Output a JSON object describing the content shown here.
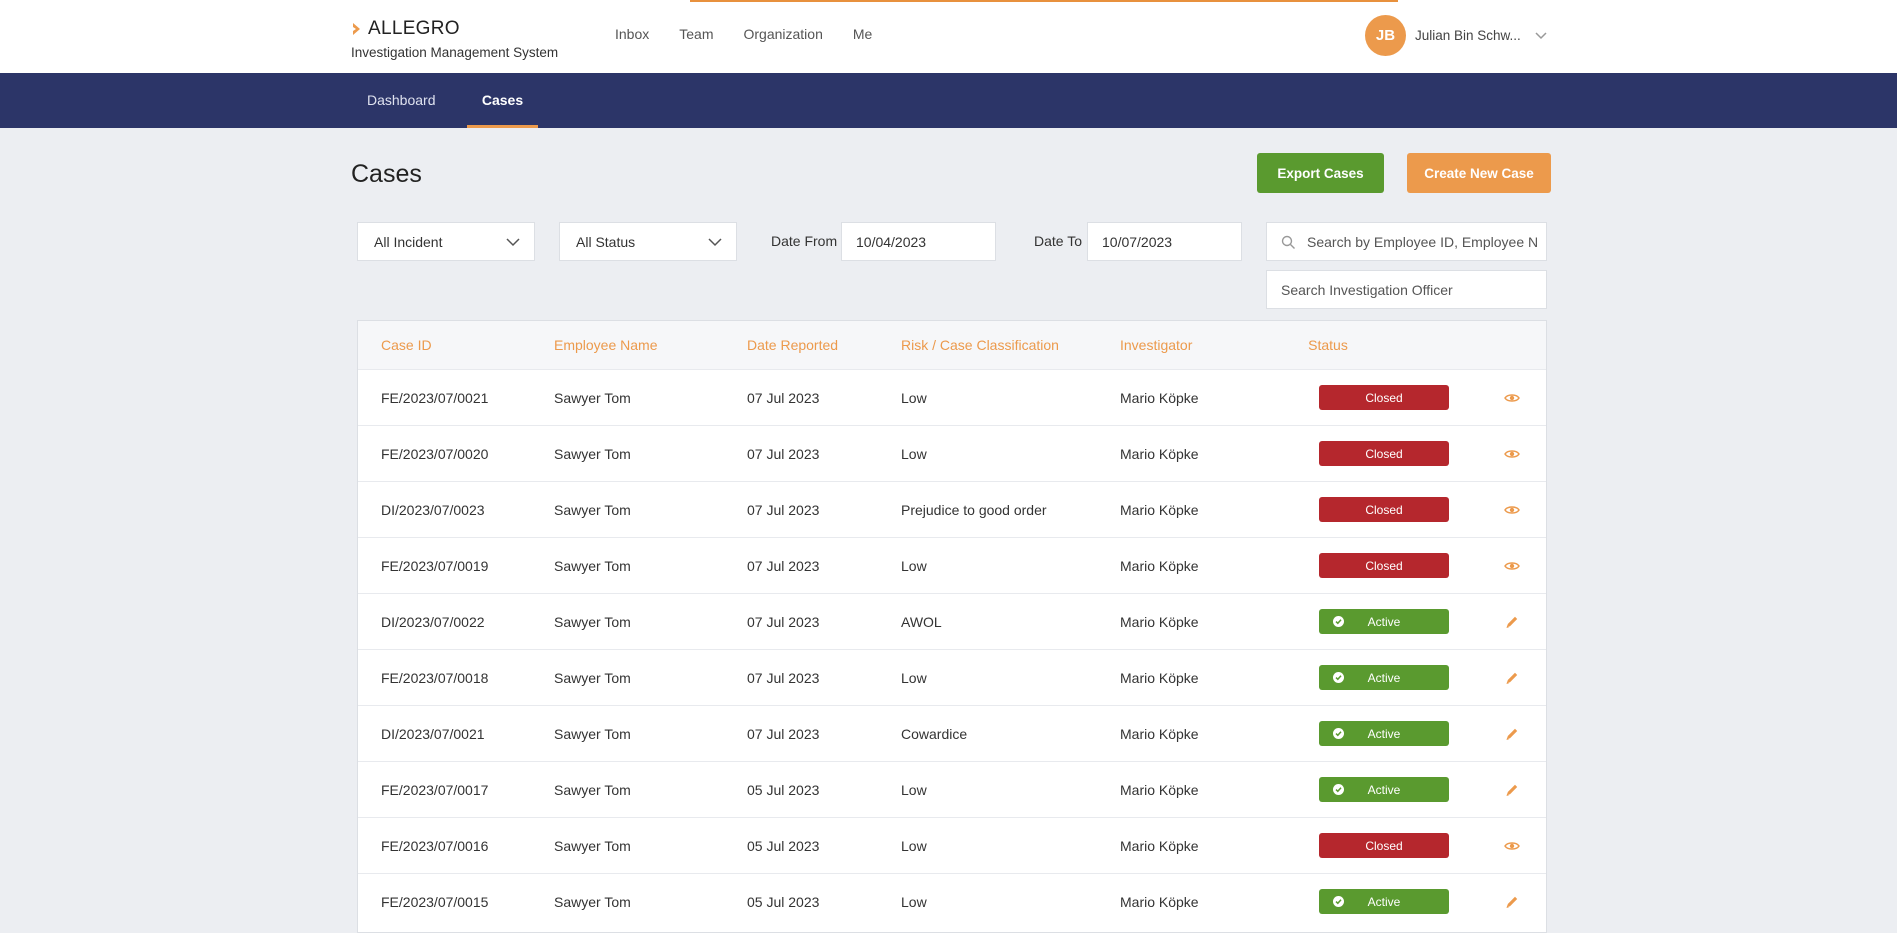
{
  "brand": {
    "name": "ALLEGRO",
    "subtitle": "Investigation Management System"
  },
  "top_nav": [
    "Inbox",
    "Team",
    "Organization",
    "Me"
  ],
  "user": {
    "initials": "JB",
    "name": "Julian Bin Schw..."
  },
  "sub_nav": [
    {
      "label": "Dashboard",
      "active": false
    },
    {
      "label": "Cases",
      "active": true
    }
  ],
  "page": {
    "title": "Cases"
  },
  "actions": {
    "export_label": "Export Cases",
    "create_label": "Create New Case"
  },
  "filters": {
    "incident": "All Incident",
    "status": "All Status",
    "date_from_label": "Date From",
    "date_from": "10/04/2023",
    "date_to_label": "Date To",
    "date_to": "10/07/2023",
    "search_employee_placeholder": "Search by Employee ID, Employee Name",
    "search_officer_placeholder": "Search Investigation Officer"
  },
  "table": {
    "headers": [
      "Case ID",
      "Employee Name",
      "Date Reported",
      "Risk / Case Classification",
      "Investigator",
      "Status"
    ],
    "rows": [
      {
        "case_id": "FE/2023/07/0021",
        "employee": "Sawyer Tom",
        "date": "07 Jul 2023",
        "classification": "Low",
        "investigator": "Mario Köpke",
        "status": "Closed",
        "action": "eye-icon"
      },
      {
        "case_id": "FE/2023/07/0020",
        "employee": "Sawyer Tom",
        "date": "07 Jul 2023",
        "classification": "Low",
        "investigator": "Mario Köpke",
        "status": "Closed",
        "action": "eye-icon"
      },
      {
        "case_id": "DI/2023/07/0023",
        "employee": "Sawyer Tom",
        "date": "07 Jul 2023",
        "classification": "Prejudice to good order",
        "investigator": "Mario Köpke",
        "status": "Closed",
        "action": "eye-icon"
      },
      {
        "case_id": "FE/2023/07/0019",
        "employee": "Sawyer Tom",
        "date": "07 Jul 2023",
        "classification": "Low",
        "investigator": "Mario Köpke",
        "status": "Closed",
        "action": "eye-icon"
      },
      {
        "case_id": "DI/2023/07/0022",
        "employee": "Sawyer Tom",
        "date": "07 Jul 2023",
        "classification": "AWOL",
        "investigator": "Mario Köpke",
        "status": "Active",
        "action": "pencil-icon"
      },
      {
        "case_id": "FE/2023/07/0018",
        "employee": "Sawyer Tom",
        "date": "07 Jul 2023",
        "classification": "Low",
        "investigator": "Mario Köpke",
        "status": "Active",
        "action": "pencil-icon"
      },
      {
        "case_id": "DI/2023/07/0021",
        "employee": "Sawyer Tom",
        "date": "07 Jul 2023",
        "classification": "Cowardice",
        "investigator": "Mario Köpke",
        "status": "Active",
        "action": "pencil-icon"
      },
      {
        "case_id": "FE/2023/07/0017",
        "employee": "Sawyer Tom",
        "date": "05 Jul 2023",
        "classification": "Low",
        "investigator": "Mario Köpke",
        "status": "Active",
        "action": "pencil-icon"
      },
      {
        "case_id": "FE/2023/07/0016",
        "employee": "Sawyer Tom",
        "date": "05 Jul 2023",
        "classification": "Low",
        "investigator": "Mario Köpke",
        "status": "Closed",
        "action": "eye-icon"
      },
      {
        "case_id": "FE/2023/07/0015",
        "employee": "Sawyer Tom",
        "date": "05 Jul 2023",
        "classification": "Low",
        "investigator": "Mario Köpke",
        "status": "Active",
        "action": "pencil-icon"
      }
    ]
  },
  "colors": {
    "accent": "#ec9a4c",
    "navy": "#2c3568",
    "success": "#5a9a2f",
    "danger": "#b5272d"
  }
}
